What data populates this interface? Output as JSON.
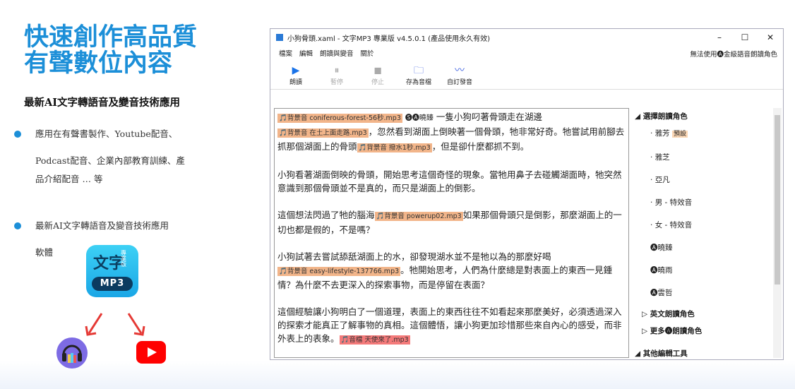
{
  "hero": {
    "line1": "快速創作高品質",
    "line2": "有聲數位內容"
  },
  "subtitle": "最新AI文字轉語音及變音技術應用",
  "bullets": [
    {
      "line1": "應用在有聲書製作、Youtube配音、",
      "line2": "Podcast配音、企業內部教育訓練、產",
      "line3": "品介紹配音 … 等"
    },
    {
      "line1": "最新AI文字轉語音及變音技術應用",
      "line2": "軟體"
    }
  ],
  "app_icon": {
    "main": "文字",
    "side": "專業版",
    "badge": "MP3"
  },
  "window": {
    "title": "小狗骨頭.xaml - 文字MP3 專業版 v4.5.0.1 (產品使用永久有效)",
    "controls": [
      "–",
      "☐",
      "✕"
    ],
    "menu": [
      "檔案",
      "編輯",
      "朗讀與變音",
      "關於"
    ],
    "menu_right": "無法使用🅐金級語音朗讀角色",
    "toolbar": [
      {
        "label": "朗讀",
        "icon": "play-icon"
      },
      {
        "label": "暫停",
        "icon": "pause-icon"
      },
      {
        "label": "停止",
        "icon": "stop-icon"
      },
      {
        "label": "存為音檔",
        "icon": "folder-icon"
      },
      {
        "label": "自訂發音",
        "icon": "voice-icon"
      }
    ]
  },
  "editor": {
    "p1": {
      "tag1": "🎵背景音 coniferous-forest-56秒.mp3",
      "voice": "🅢🅐曉臻",
      "t1": "一隻小狗叼著骨頭走在湖邊",
      "tag2": "🎵背景音 在土上面走路.mp3",
      "t2": "，忽然看到湖面上倒映著一個骨頭，牠非常好奇。牠嘗試用前腳去抓那個湖面上的骨頭",
      "tag3": "🎵背景音 撥水1秒.mp3",
      "t3": "，但是卻什麼都抓不到。"
    },
    "p2": "小狗看著湖面倒映的骨頭，開始思考這個奇怪的現象。當牠用鼻子去碰觸湖面時，牠突然意識到那個骨頭並不是真的，而只是湖面上的倒影。",
    "p3": {
      "t1": "這個想法閃過了牠的腦海",
      "tag": "🎵背景音 powerup02.mp3",
      "t2": "如果那個骨頭只是倒影，那麼湖面上的一切也都是假的，不是嗎？"
    },
    "p4": {
      "t1": "小狗試著去嘗試舔舐湖面上的水，卻發現湖水並不是牠以為的那麼好喝",
      "tag": "🎵背景音 easy-lifestyle-137766.mp3",
      "t2": "。牠開始思考，人們為什麼總是對表面上的東西一見鍾情？為什麼不去更深入的探索事物，而是停留在表面？"
    },
    "p5": {
      "t1": "這個經驗讓小狗明白了一個道理，表面上的東西往往不如看起來那麼美好，必須透過深入的探索才能真正了解事物的真相。這個體悟，讓小狗更加珍惜那些來自內心的感受，而非外表上的表象。",
      "tag": "🎵音檔 天使來了.mp3"
    }
  },
  "side": {
    "header": "選擇朗讀角色",
    "voices": [
      "雅芳",
      "雅芝",
      "亞凡",
      "男 - 特效音",
      "女 - 特效音",
      "🅐曉臻",
      "🅐曉雨",
      "🅐雲哲"
    ],
    "preset": "預設",
    "groups": [
      "英文朗讀角色",
      "更多🅐朗讀角色",
      "其他編輯工具"
    ]
  }
}
